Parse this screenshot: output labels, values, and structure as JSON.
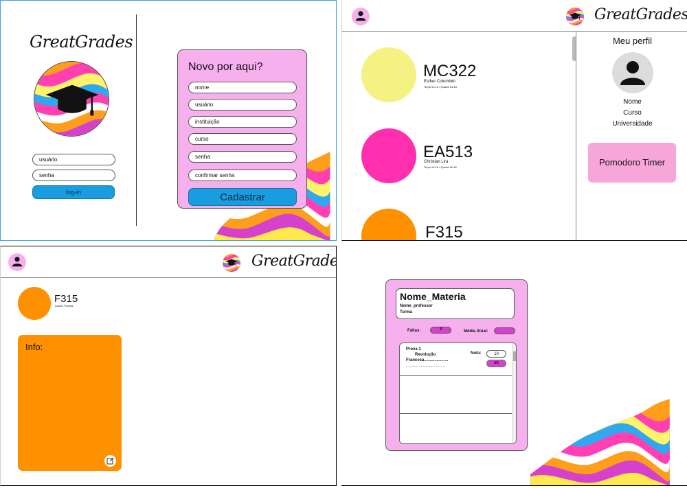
{
  "login": {
    "logo": "GreatGrades",
    "username_placeholder": "usuário",
    "password_placeholder": "senha",
    "login_button": "log-in"
  },
  "signup": {
    "title": "Novo por aqui?",
    "fields": [
      "nome",
      "usuário",
      "instituição",
      "curso",
      "senha",
      "confirmar senha"
    ],
    "submit_button": "Cadastrar"
  },
  "dashboard": {
    "brand": "GreatGrades",
    "courses": [
      {
        "code": "MC322",
        "professor": "Esther Columbini",
        "schedule": "Terça 10-12 / Quarta 14-16",
        "color": "#f4f282"
      },
      {
        "code": "EA513",
        "professor": "Christian Lira",
        "schedule": "Terça 16-18 / Quinta 16-18",
        "color": "#ff2fb0"
      },
      {
        "code": "F315",
        "professor": "",
        "schedule": "",
        "color": "#ff9100"
      }
    ],
    "profile": {
      "title": "Meu perfil",
      "name": "Nome",
      "course": "Curso",
      "university": "Universidade"
    },
    "pomodoro_button": "Pomodoro Timer"
  },
  "course_detail": {
    "brand": "GreatGrades",
    "code": "F315",
    "professor": "Lazaro Pedrha",
    "info_title": "Info:",
    "color": "#ff9100"
  },
  "subject": {
    "name": "Nome_Materia",
    "professor": "Nome_professor",
    "class": "Turma",
    "absences_label": "Faltas:",
    "absences_value": "3",
    "average_label": "Média Atual:",
    "average_value": "",
    "grades": [
      {
        "title": "Prova 1",
        "description_line1": "Revolução",
        "description_line2": "Francesa.....................",
        "description_line3": "..................................",
        "grade_label": "Nota:",
        "grade_value": "10",
        "ok_button": "ok"
      }
    ]
  },
  "colors": {
    "pink": "#f7b0ee",
    "blue": "#1a9cde",
    "magenta": "#d641cc",
    "orange": "#ff9100"
  }
}
